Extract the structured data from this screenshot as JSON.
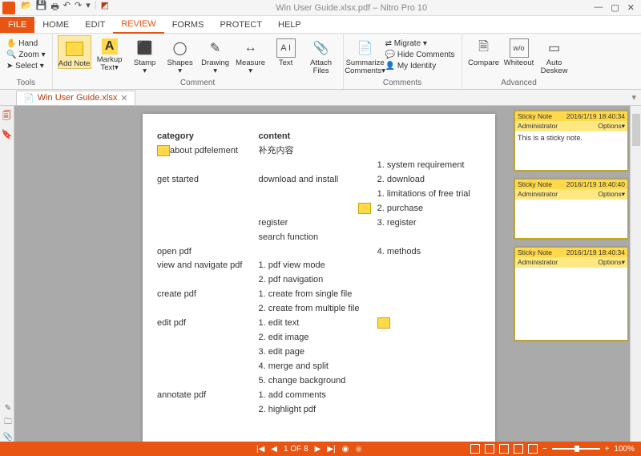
{
  "titlebar": {
    "filename": "Win User Guide.xlsx.pdf",
    "app": "Nitro Pro 10"
  },
  "tabs": {
    "file": "FILE",
    "home": "HOME",
    "edit": "EDIT",
    "review": "REVIEW",
    "forms": "FORMS",
    "protect": "PROTECT",
    "help": "HELP"
  },
  "ribbon": {
    "tools": {
      "label": "Tools",
      "hand": "Hand",
      "zoom": "Zoom",
      "select": "Select"
    },
    "comment": {
      "label": "Comment",
      "addnote": "Add Note",
      "markup": "Markup Text",
      "stamp": "Stamp",
      "shapes": "Shapes",
      "drawing": "Drawing",
      "measure": "Measure",
      "text": "Text",
      "attach": "Attach Files"
    },
    "comments": {
      "label": "Comments",
      "summarize": "Summarize Comments",
      "migrate": "Migrate",
      "hide": "Hide Comments",
      "identity": "My Identity"
    },
    "advanced": {
      "label": "Advanced",
      "compare": "Compare",
      "whiteout": "Whiteout",
      "deskew": "Auto Deskew"
    }
  },
  "doctab": {
    "name": "Win User Guide.xlsx"
  },
  "page": {
    "col1": "category",
    "col2": "content",
    "r1a": "about pdfelement",
    "r1b": "补充内容",
    "r2a": "get started",
    "r2b": "download and install",
    "r2c1": "1. system requirement",
    "r2c2": "2. download",
    "r2c3": "1. limitations of free trial",
    "r2c4": "2. purchase",
    "r2c5": "3. register",
    "r3b1": "register",
    "r3b2": "search function",
    "r3c": "4. methods",
    "r4a": "open pdf",
    "r5a": "view and navigate pdf",
    "r5b1": "1. pdf view mode",
    "r5b2": "2. pdf navigation",
    "r6a": "create pdf",
    "r6b1": "1. create from single file",
    "r6b2": "2. create from multiple file",
    "r7a": "edit pdf",
    "r7b1": "1. edit text",
    "r7b2": "2. edit image",
    "r7b3": "3. edit page",
    "r7b4": "4. merge and split",
    "r7b5": "5. change background",
    "r8a": "annotate pdf",
    "r8b1": "1. add comments",
    "r8b2": "2. highlight pdf"
  },
  "stickies": [
    {
      "title": "Sticky Note",
      "date": "2016/1/19 18:40:34",
      "author": "Administrator",
      "options": "Options",
      "body": "This is a sticky note."
    },
    {
      "title": "Sticky Note",
      "date": "2016/1/19 18:40:40",
      "author": "Administrator",
      "options": "Options",
      "body": ""
    },
    {
      "title": "Sticky Note",
      "date": "2016/1/19 18:40:34",
      "author": "Administrator",
      "options": "Options",
      "body": ""
    }
  ],
  "status": {
    "page": "1 OF 8",
    "zoom": "100%"
  }
}
